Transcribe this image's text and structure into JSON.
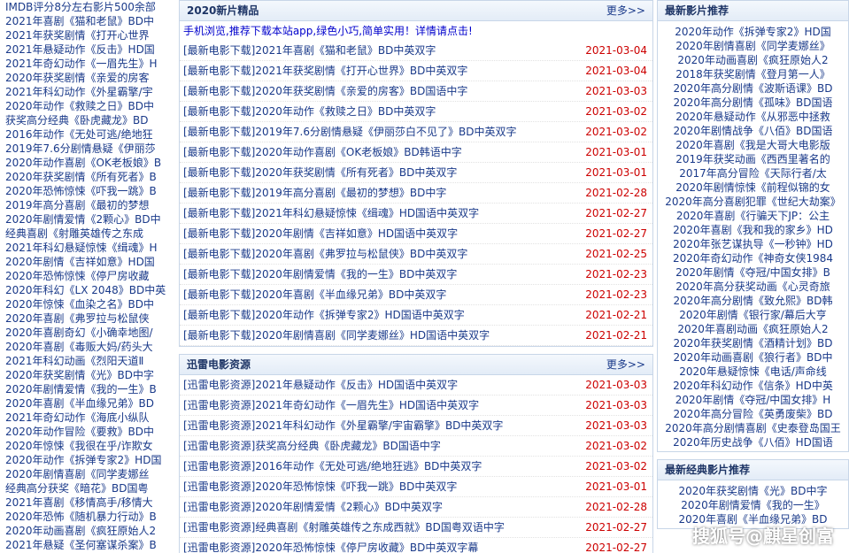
{
  "left_list": [
    "IMDB评分8分左右影片500余部",
    "2021年喜剧《猫和老鼠》BD中",
    "2021年获奖剧情《打开心世界",
    "2021年悬疑动作《反击》HD国",
    "2021年奇幻动作《一眉先生》H",
    "2020年获奖剧情《亲爱的房客",
    "2021年科幻动作《外星霸擎/宇",
    "2020年动作《救赎之日》BD中",
    "获奖高分经典《卧虎藏龙》BD",
    "2016年动作《无处可逃/绝地狂",
    "2019年7.6分剧情悬疑《伊丽莎",
    "2020年动作喜剧《OK老板娘》B",
    "2020年获奖剧情《所有死者》B",
    "2020年恐怖惊悚《吓我一跳》B",
    "2019年高分喜剧《最初的梦想",
    "2020年剧情爱情《2颗心》BD中",
    "经典喜剧《射雕英雄传之东成",
    "2021年科幻悬疑惊悚《缉魂》H",
    "2020年剧情《吉祥如意》HD国",
    "2020年恐怖惊悚《停尸房收藏",
    "2020年科幻《LX 2048》BD中英",
    "2020年惊悚《血染之名》BD中",
    "2020年喜剧《弗罗拉与松鼠侠",
    "2020年喜剧奇幻《小确幸地图/",
    "2020年喜剧《毒贩大妈/药头大",
    "2021年科幻动画《烈阳天道Ⅱ",
    "2020年获奖剧情《光》BD中字",
    "2020年剧情爱情《我的一生》B",
    "2020年喜剧《半血缘兄弟》BD",
    "2021年奇幻动作《海底小纵队",
    "2020年动作冒险《要救》BD中",
    "2020年惊悚《我很在乎/诈欺女",
    "2020年动作《拆弹专家2》HD国",
    "2020年剧情喜剧《同学麦娜丝",
    "经典高分获奖《暗花》BD国粤",
    "2021年喜剧《移情高手/移情大",
    "2020年恐怖《随机暴力行动》B",
    "2020年动画喜剧《疯狂原始人2",
    "2021年悬疑《圣何塞谋杀案》B"
  ],
  "section1": {
    "title": "2020新片精品",
    "more": "更多>>",
    "promo": "手机浏览,推荐下载本站app,绿色小巧,简单实用！详情请点击!",
    "items": [
      {
        "t": "[最新电影下载]2021年喜剧《猫和老鼠》BD中英双字",
        "d": "2021-03-04"
      },
      {
        "t": "[最新电影下载]2021年获奖剧情《打开心世界》BD中英双字",
        "d": "2021-03-04"
      },
      {
        "t": "[最新电影下载]2020年获奖剧情《亲爱的房客》BD国语中字",
        "d": "2021-03-03"
      },
      {
        "t": "[最新电影下载]2020年动作《救赎之日》BD中英双字",
        "d": "2021-03-02"
      },
      {
        "t": "[最新电影下载]2019年7.6分剧情悬疑《伊丽莎白不见了》BD中英双字",
        "d": "2021-03-02"
      },
      {
        "t": "[最新电影下载]2020年动作喜剧《OK老板娘》BD韩语中字",
        "d": "2021-03-01"
      },
      {
        "t": "[最新电影下载]2020年获奖剧情《所有死者》BD中英双字",
        "d": "2021-03-01"
      },
      {
        "t": "[最新电影下载]2019年高分喜剧《最初的梦想》BD中字",
        "d": "2021-02-28"
      },
      {
        "t": "[最新电影下载]2021年科幻悬疑惊悚《缉魂》HD国语中英双字",
        "d": "2021-02-27"
      },
      {
        "t": "[最新电影下载]2020年剧情《吉祥如意》HD国语中英双字",
        "d": "2021-02-27"
      },
      {
        "t": "[最新电影下载]2020年喜剧《弗罗拉与松鼠侠》BD中英双字",
        "d": "2021-02-25"
      },
      {
        "t": "[最新电影下载]2020年剧情爱情《我的一生》BD中英双字",
        "d": "2021-02-23"
      },
      {
        "t": "[最新电影下载]2020年喜剧《半血缘兄弟》BD中英双字",
        "d": "2021-02-23"
      },
      {
        "t": "[最新电影下载]2020年动作《拆弹专家2》HD国语中英双字",
        "d": "2021-02-21"
      },
      {
        "t": "[最新电影下载]2020年剧情喜剧《同学麦娜丝》HD国语中英双字",
        "d": "2021-02-21"
      }
    ]
  },
  "section2": {
    "title": "迅雷电影资源",
    "more": "更多>>",
    "items": [
      {
        "t": "[迅雷电影资源]2021年悬疑动作《反击》HD国语中英双字",
        "d": "2021-03-03"
      },
      {
        "t": "[迅雷电影资源]2021年奇幻动作《一眉先生》HD国语中英双字",
        "d": "2021-03-03"
      },
      {
        "t": "[迅雷电影资源]2021年科幻动作《外星霸擎/宇宙霸擎》BD中英双字",
        "d": "2021-03-03"
      },
      {
        "t": "[迅雷电影资源]获奖高分经典《卧虎藏龙》BD国语中字",
        "d": "2021-03-02"
      },
      {
        "t": "[迅雷电影资源]2016年动作《无处可逃/绝地狂逃》BD中英双字",
        "d": "2021-03-02"
      },
      {
        "t": "[迅雷电影资源]2020年恐怖惊悚《吓我一跳》BD中英双字",
        "d": "2021-03-01"
      },
      {
        "t": "[迅雷电影资源]2020年剧情爱情《2颗心》BD中英双字",
        "d": "2021-02-28"
      },
      {
        "t": "[迅雷电影资源]经典喜剧《射雕英雄传之东成西就》BD国粤双语中字",
        "d": "2021-02-27"
      },
      {
        "t": "[迅雷电影资源]2020年恐怖惊悚《停尸房收藏》BD中英双字幕",
        "d": "2021-02-27"
      },
      {
        "t": "[迅雷电影资源]2020年科幻《LX 2048》BD中英双字",
        "d": "2021-02-26"
      }
    ]
  },
  "right1": {
    "title": "最新影片推荐",
    "items": [
      "2020年动作《拆弹专家2》HD国",
      "2020年剧情喜剧《同学麦娜丝》",
      "2020年动画喜剧《疯狂原始人2",
      "2018年获奖剧情《登月第一人》",
      "2020年高分剧情《波斯语课》BD",
      "2020年高分剧情《孤味》BD国语",
      "2020年悬疑动作《从邪恶中拯救",
      "2020年剧情战争《八佰》BD国语",
      "2020年喜剧《我是大哥大电影版",
      "2019年获奖动画《西西里著名的",
      "2017年高分冒险《天际行者/太",
      "2020年剧情惊悚《前程似锦的女",
      "2020年高分喜剧犯罪《世纪大劫案》",
      "2020年喜剧《行骗天下JP：公主",
      "2020年喜剧《我和我的家乡》HD",
      "2020年张艺谋执导《一秒钟》HD",
      "2020年奇幻动作《神奇女侠1984",
      "2020年剧情《夺冠/中国女排》B",
      "2020年高分获奖动画《心灵奇旅",
      "2020年高分剧情《致允熙》BD韩",
      "2020年剧情《银行家/幕后大亨",
      "2020年喜剧动画《疯狂原始人2",
      "2020年获奖剧情《酒精计划》BD",
      "2020年动画喜剧《狼行者》BD中",
      "2020年悬疑惊悚《电话/声命线",
      "2020年科幻动作《信条》HD中英",
      "2020年剧情《夺冠/中国女排》H",
      "2020年高分冒险《英勇废柴》BD",
      "2020年高分剧情喜剧《史泰登岛国王",
      "2020年历史战争《八佰》HD国语"
    ]
  },
  "right2": {
    "title": "最新经典影片推荐",
    "items": [
      "2020年获奖剧情《光》BD中字",
      "2020年剧情爱情《我的一生》",
      "2020年喜剧《半血缘兄弟》BD"
    ]
  },
  "watermark": "搜狐号@麒星创富"
}
